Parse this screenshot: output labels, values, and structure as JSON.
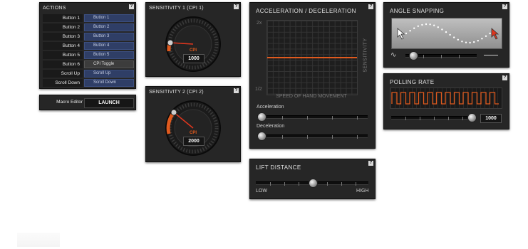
{
  "actions": {
    "title": "ACTIONS",
    "help": "?",
    "rows": [
      {
        "label": "Button 1",
        "action": "Button 1"
      },
      {
        "label": "Button 2",
        "action": "Button 2"
      },
      {
        "label": "Button 3",
        "action": "Button 3"
      },
      {
        "label": "Button 4",
        "action": "Button 4"
      },
      {
        "label": "Button 5",
        "action": "Button 5"
      },
      {
        "label": "Button 6",
        "action": "CPI Toggle"
      },
      {
        "label": "Scroll Up",
        "action": "Scroll Up"
      },
      {
        "label": "Scroll Down",
        "action": "Scroll Down"
      }
    ]
  },
  "macro": {
    "label": "Macro Editor",
    "button": "LAUNCH"
  },
  "sensitivity1": {
    "title": "SENSITIVITY 1 (CPI 1)",
    "help": "?",
    "unit": "CPI",
    "value": "1000"
  },
  "sensitivity2": {
    "title": "SENSITIVITY 2 (CPI 2)",
    "help": "?",
    "unit": "CPI",
    "value": "2000"
  },
  "accel": {
    "title": "ACCELERATION / DECELERATION",
    "help": "?",
    "y_top": "2x",
    "y_bottom": "1/2",
    "x_label": "SPEED OF HAND MOVEMENT",
    "y_label": "SENSITIVITY",
    "acceleration_label": "Acceleration",
    "deceleration_label": "Deceleration"
  },
  "lift": {
    "title": "LIFT DISTANCE",
    "help": "?",
    "low": "LOW",
    "high": "HIGH",
    "level": 0.5
  },
  "angle": {
    "title": "ANGLE SNAPPING",
    "help": "?",
    "level": 0.06
  },
  "polling": {
    "title": "POLLING RATE",
    "help": "?",
    "value": "1000",
    "level": 1.0
  },
  "colors": {
    "accent": "#e05a1e",
    "panel": "#262626",
    "button_blue": "#2f3e66"
  }
}
